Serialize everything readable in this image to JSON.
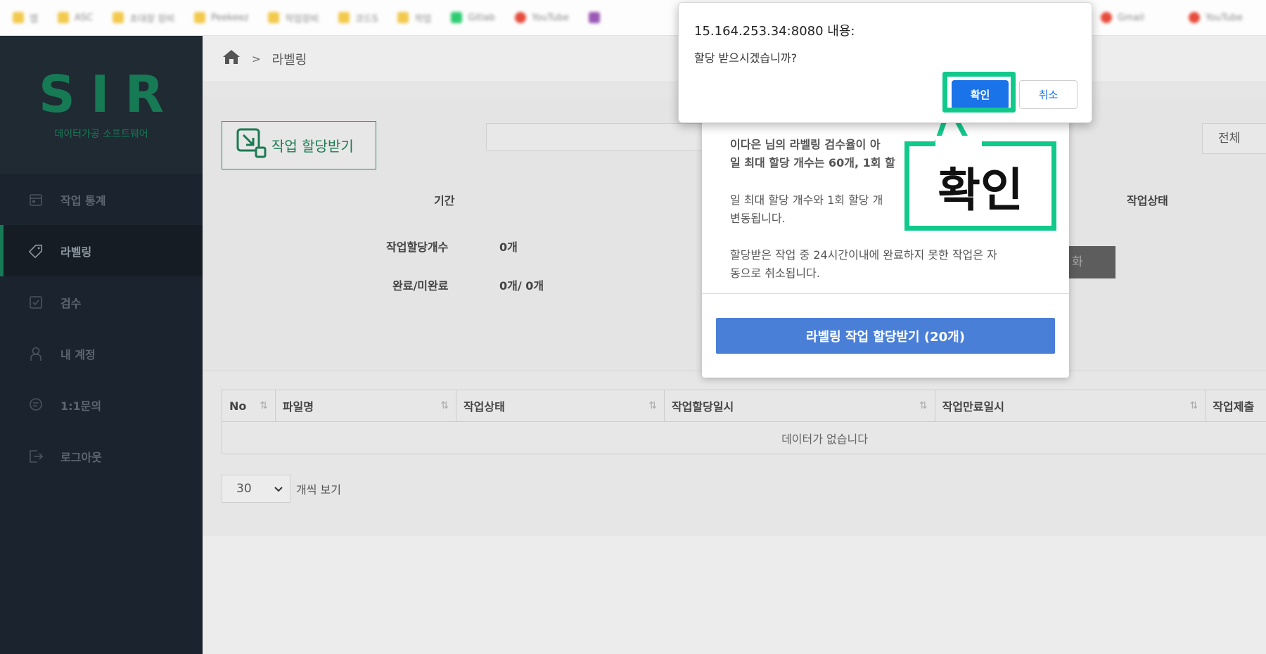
{
  "bookmarks": [
    "앱",
    "ASC",
    "초대장 장비",
    "Peekeez",
    "작업장비",
    "코드S",
    "작업",
    "Gitlab",
    "YouTube",
    "",
    "",
    "Gmail",
    "YouTube"
  ],
  "sidebar": {
    "logo": "SIR",
    "logo_sub": "데이터가공 소프트웨어",
    "items": [
      {
        "label": "작업 통계",
        "icon": "calendar-icon"
      },
      {
        "label": "라벨링",
        "icon": "tag-icon"
      },
      {
        "label": "검수",
        "icon": "check-icon"
      },
      {
        "label": "내 계정",
        "icon": "user-icon"
      },
      {
        "label": "1:1문의",
        "icon": "chat-icon"
      },
      {
        "label": "로그아웃",
        "icon": "logout-icon"
      }
    ]
  },
  "breadcrumb": {
    "separator": ">",
    "current": "라벨링"
  },
  "panel": {
    "assign_button": "작업 할당받기",
    "period_label": "기간",
    "status_label": "작업상태",
    "status_value": "전체",
    "assigned_count_label": "작업할당개수",
    "assigned_count_value": "0개",
    "complete_label": "완료/미완료",
    "complete_value": "0개/ 0개",
    "reset_button": "화"
  },
  "table": {
    "headers": [
      "No",
      "파일명",
      "작업상태",
      "작업할당일시",
      "작업만료일시",
      "작업제출"
    ],
    "empty_text": "데이터가 없습니다",
    "page_size": "30",
    "page_size_suffix": "개씩 보기"
  },
  "modal": {
    "line1": "이다은 님의 라벨링 검수율이 아",
    "line2": "일 최대 할당 개수는 60개, 1회 할",
    "line3": "일 최대 할당 개수와 1회 할당 개",
    "line4": "변동됩니다.",
    "line5": "할당받은 작업 중 24시간이내에 완료하지 못한 작업은 자",
    "line6": "동으로 취소됩니다.",
    "button": "라벨링 작업 할당받기 (20개)"
  },
  "alert": {
    "title": "15.164.253.34:8080 내용:",
    "message": "할당 받으시겠습니까?",
    "ok": "확인",
    "cancel": "취소"
  },
  "callout": {
    "text": "확인"
  },
  "colors": {
    "brand": "#167a55",
    "highlight": "#12c98c",
    "alert_ok": "#1a73e8",
    "modal_button": "#4a7fd8",
    "sidebar": "#1b242e"
  }
}
